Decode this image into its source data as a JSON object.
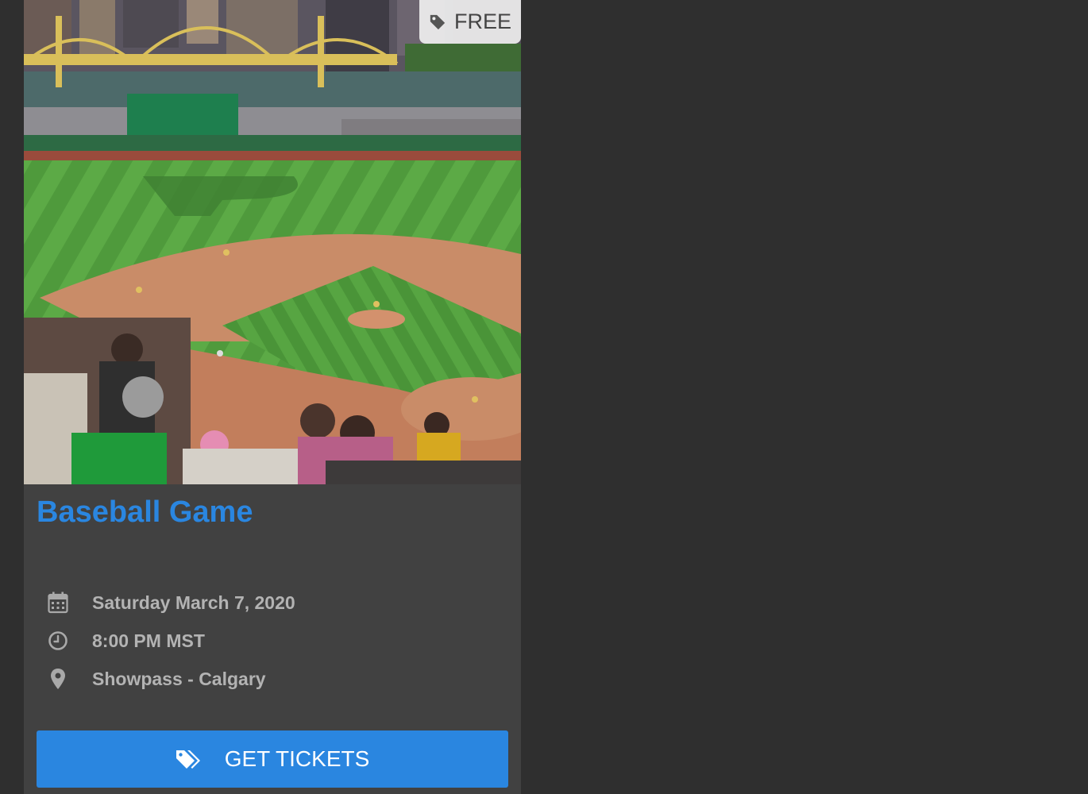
{
  "event": {
    "image_alt": "Baseball stadium aerial view",
    "price_badge": {
      "label": "FREE",
      "icon": "tag-icon"
    },
    "title": "Baseball Game",
    "date": "Saturday March 7, 2020",
    "time": "8:00 PM MST",
    "location": "Showpass - Calgary",
    "cta": {
      "label": "GET TICKETS",
      "icon": "tags-icon"
    }
  },
  "colors": {
    "page_bg": "#2f2f2f",
    "card_bg": "#414141",
    "accent": "#2a86e0",
    "detail_text": "#b3b3b3"
  }
}
